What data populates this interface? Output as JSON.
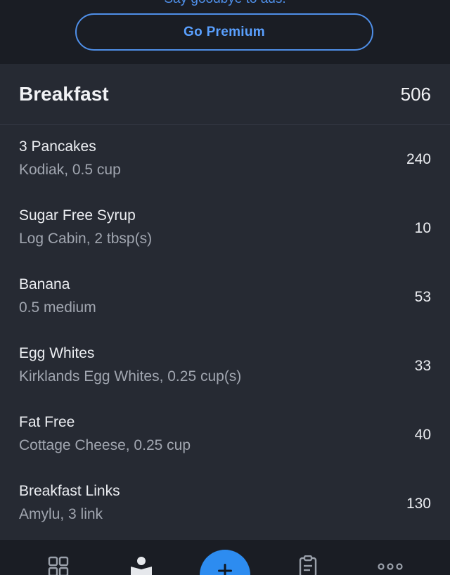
{
  "premium": {
    "tagline": "Say goodbye to ads.",
    "button_label": "Go Premium"
  },
  "meal": {
    "title": "Breakfast",
    "total_calories": "506",
    "items": [
      {
        "name": "3 Pancakes",
        "desc": "Kodiak, 0.5 cup",
        "calories": "240"
      },
      {
        "name": "Sugar Free Syrup",
        "desc": "Log Cabin, 2 tbsp(s)",
        "calories": "10"
      },
      {
        "name": "Banana",
        "desc": "0.5 medium",
        "calories": "53"
      },
      {
        "name": "Egg Whites",
        "desc": "Kirklands Egg Whites, 0.25 cup(s)",
        "calories": "33"
      },
      {
        "name": "Fat Free",
        "desc": "Cottage Cheese, 0.25 cup",
        "calories": "40"
      },
      {
        "name": "Breakfast Links",
        "desc": "Amylu, 3 link",
        "calories": "130"
      }
    ]
  },
  "tabbar": {
    "icons": [
      "dashboard-icon",
      "diary-icon",
      "add-icon",
      "plans-icon",
      "more-icon"
    ]
  },
  "colors": {
    "accent": "#2d8cf0",
    "link": "#5aa0ff",
    "background": "#1c1f26",
    "card": "#262a33"
  }
}
